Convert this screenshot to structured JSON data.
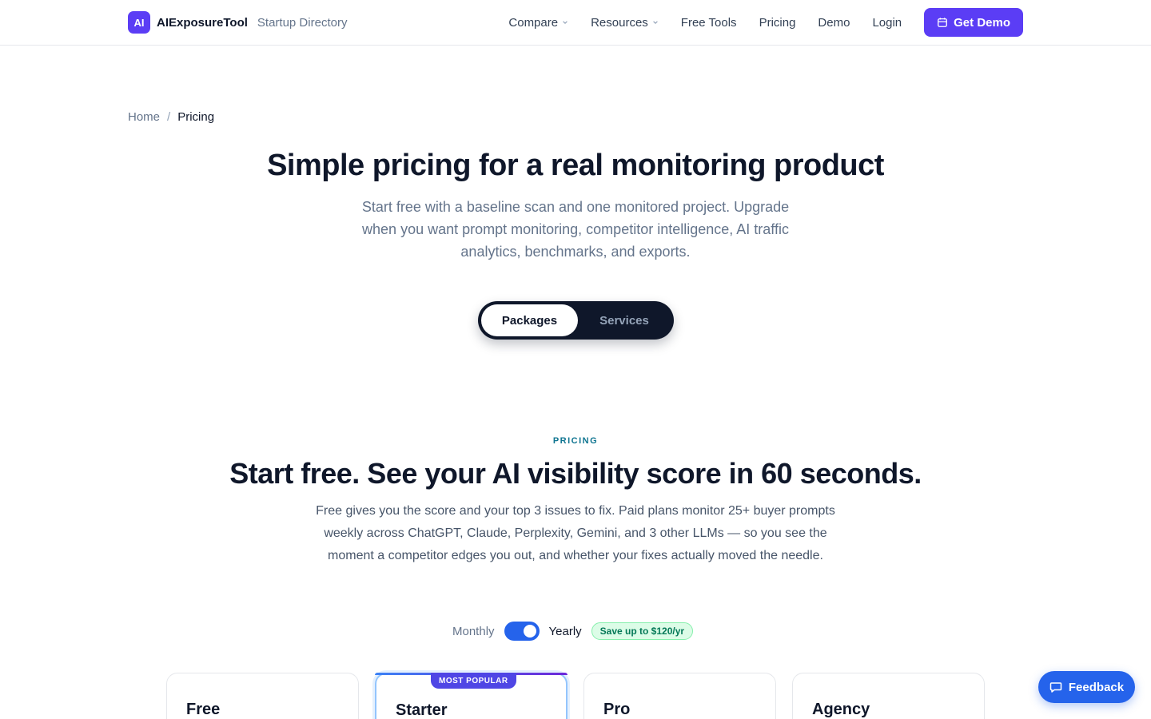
{
  "header": {
    "logo_text": "AI",
    "brand_name": "AIExposureTool",
    "brand_sub": "Startup Directory",
    "nav": [
      {
        "label": "Compare",
        "dropdown": true,
        "icon": "chevron-down-icon"
      },
      {
        "label": "Resources",
        "dropdown": true,
        "icon": "chevron-down-icon"
      },
      {
        "label": "Free Tools",
        "dropdown": false
      },
      {
        "label": "Pricing",
        "dropdown": false
      },
      {
        "label": "Demo",
        "dropdown": false
      },
      {
        "label": "Login",
        "dropdown": false
      }
    ],
    "cta_label": "Get Demo",
    "cta_icon": "calendar-icon"
  },
  "breadcrumb": {
    "home": "Home",
    "separator": "/",
    "current": "Pricing"
  },
  "hero": {
    "title": "Simple pricing for a real monitoring product",
    "subtitle": "Start free with a baseline scan and one monitored project. Upgrade when you want prompt monitoring, competitor intelligence, AI traffic analytics, benchmarks, and exports."
  },
  "segment": {
    "active": "Packages",
    "inactive": "Services"
  },
  "pricing": {
    "eyebrow": "PRICING",
    "title": "Start free. See your AI visibility score in 60 seconds.",
    "subtitle": "Free gives you the score and your top 3 issues to fix. Paid plans monitor 25+ buyer prompts weekly across ChatGPT, Claude, Perplexity, Gemini, and 3 other LLMs — so you see the moment a competitor edges you out, and whether your fixes actually moved the needle."
  },
  "billing": {
    "monthly": "Monthly",
    "yearly": "Yearly",
    "yearly_selected": true,
    "save_badge": "Save up to $120/yr"
  },
  "plans": [
    {
      "name": "Free",
      "popular": false
    },
    {
      "name": "Starter",
      "popular": true,
      "badge": "MOST POPULAR"
    },
    {
      "name": "Pro",
      "popular": false
    },
    {
      "name": "Agency",
      "popular": false
    }
  ],
  "feedback": {
    "label": "Feedback",
    "icon": "chat-bubble-icon"
  },
  "colors": {
    "brand": "#5b3df5",
    "accent_blue": "#2563eb",
    "dark": "#0f172a",
    "eyebrow": "#0e7490",
    "save_badge_bg": "#dcfce7"
  }
}
